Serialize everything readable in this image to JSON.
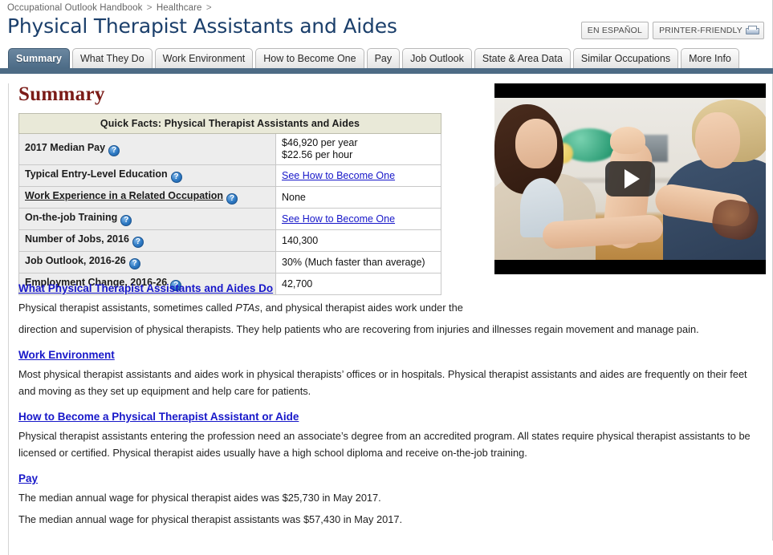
{
  "breadcrumb": {
    "items": [
      "Occupational Outlook Handbook",
      "Healthcare"
    ],
    "separator": ">",
    "trailing_separator": ">"
  },
  "header": {
    "title": "Physical Therapist Assistants and Aides",
    "buttons": {
      "spanish": "EN ESPAÑOL",
      "printer_friendly": "PRINTER-FRIENDLY",
      "printer_icon": "printer-icon"
    }
  },
  "tabs": [
    {
      "label": "Summary",
      "active": true
    },
    {
      "label": "What They Do",
      "active": false
    },
    {
      "label": "Work Environment",
      "active": false
    },
    {
      "label": "How to Become One",
      "active": false
    },
    {
      "label": "Pay",
      "active": false
    },
    {
      "label": "Job Outlook",
      "active": false
    },
    {
      "label": "State & Area Data",
      "active": false
    },
    {
      "label": "Similar Occupations",
      "active": false
    },
    {
      "label": "More Info",
      "active": false
    }
  ],
  "main": {
    "heading": "Summary",
    "quick_facts": {
      "caption": "Quick Facts: Physical Therapist Assistants and Aides",
      "help_icon": "help-icon",
      "help_glyph": "?",
      "rows": [
        {
          "label": "2017 Median Pay",
          "label_underlined": false,
          "has_help": true,
          "value_lines": [
            "$46,920 per year",
            "$22.56 per hour"
          ],
          "is_link": false
        },
        {
          "label": "Typical Entry-Level Education",
          "label_underlined": false,
          "has_help": true,
          "value_lines": [
            "See How to Become One"
          ],
          "is_link": true
        },
        {
          "label": "Work Experience in a Related Occupation",
          "label_underlined": true,
          "has_help": true,
          "value_lines": [
            "None"
          ],
          "is_link": false
        },
        {
          "label": "On-the-job Training",
          "label_underlined": false,
          "has_help": true,
          "value_lines": [
            "See How to Become One"
          ],
          "is_link": true
        },
        {
          "label": "Number of Jobs, 2016",
          "label_underlined": false,
          "has_help": true,
          "value_lines": [
            "140,300"
          ],
          "is_link": false
        },
        {
          "label": "Job Outlook, 2016-26",
          "label_underlined": false,
          "has_help": true,
          "value_lines": [
            "30% (Much faster than average)"
          ],
          "is_link": false
        },
        {
          "label": "Employment Change, 2016-26",
          "label_underlined": false,
          "has_help": true,
          "value_lines": [
            "42,700"
          ],
          "is_link": false
        }
      ]
    },
    "video": {
      "name": "occupation-video-thumbnail",
      "play_button": "play-icon"
    },
    "sections": [
      {
        "heading": "What Physical Therapist Assistants and Aides Do",
        "paragraphs": [
          {
            "before": "Physical therapist assistants, sometimes called ",
            "italic": "PTAs",
            "after": ", and physical therapist aides work under the"
          },
          {
            "before": "direction and supervision of physical therapists. They help patients who are recovering from injuries and illnesses regain movement and manage pain.",
            "italic": "",
            "after": ""
          }
        ]
      },
      {
        "heading": "Work Environment",
        "paragraphs": [
          {
            "before": "Most physical therapist assistants and aides work in physical therapists’ offices or in hospitals. Physical therapist assistants and aides are frequently on their feet and moving as they set up equipment and help care for patients.",
            "italic": "",
            "after": ""
          }
        ]
      },
      {
        "heading": "How to Become a Physical Therapist Assistant or Aide",
        "paragraphs": [
          {
            "before": "Physical therapist assistants entering the profession need an associate’s degree from an accredited program. All states require physical therapist assistants to be licensed or certified. Physical therapist aides usually have a high school diploma and receive on-the-job training.",
            "italic": "",
            "after": ""
          }
        ]
      },
      {
        "heading": "Pay",
        "paragraphs": [
          {
            "before": "The median annual wage for physical therapist aides was $25,730 in May 2017.",
            "italic": "",
            "after": ""
          },
          {
            "before": "The median annual wage for physical therapist assistants was $57,430 in May 2017.",
            "italic": "",
            "after": ""
          }
        ]
      }
    ]
  },
  "colors": {
    "title_blue": "#1b3f6b",
    "tab_active": "#4c6b86",
    "underline_bar": "#4d6b85",
    "heading_red": "#7b1b17",
    "link_blue": "#1717c9",
    "table_caption_bg": "#e9e9d8",
    "table_label_bg": "#ededed"
  }
}
